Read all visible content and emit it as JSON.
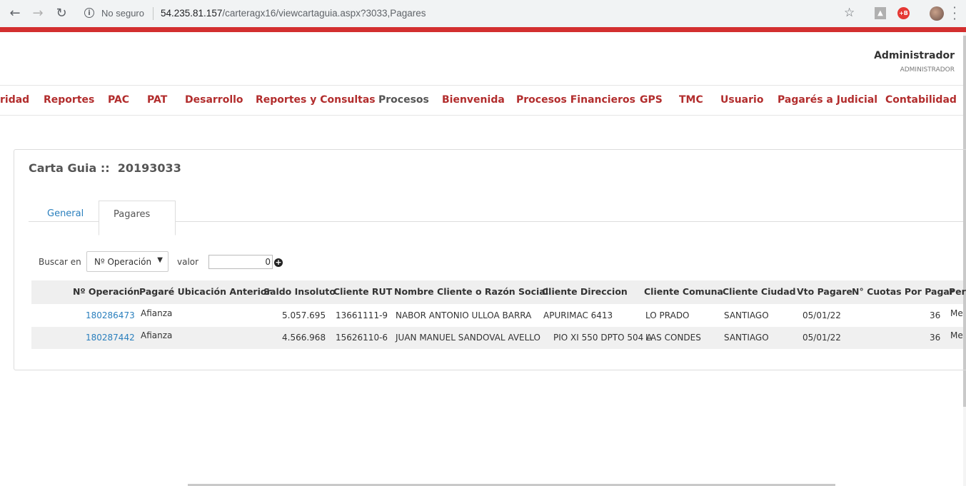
{
  "browser": {
    "security_label": "No seguro",
    "url_host": "54.235.81.157",
    "url_path": "/carteragx16/viewcartaguia.aspx?3033,Pagares",
    "ext_red_label": "+B"
  },
  "user": {
    "name": "Administrador",
    "role": "ADMINISTRADOR"
  },
  "menu": [
    "ridad",
    "Reportes",
    "PAC",
    "PAT",
    "Desarrollo",
    "Reportes y Consultas",
    "Procesos",
    "Bienvenida",
    "Procesos Financieros",
    "GPS",
    "TMC",
    "Usuario",
    "Pagarés a Judicial",
    "Contabilidad"
  ],
  "panel": {
    "title": "Carta Guia ::  20193033"
  },
  "tabs": {
    "general": "General",
    "pagares": "Pagares"
  },
  "filter": {
    "buscar_label": "Buscar en",
    "select_value": "Nº Operación",
    "valor_label": "valor",
    "valor_value": "0"
  },
  "table": {
    "headers": [
      "Nº Operación",
      "Pagaré Ubicación Anterior",
      "Saldo Insoluto",
      "Cliente RUT",
      "Nombre Cliente o Razón Social",
      "Cliente Direccion",
      "Cliente Comuna",
      "Cliente Ciudad",
      "Vto Pagare",
      "N° Cuotas Por Pagar",
      "Per"
    ],
    "rows": [
      [
        "180286473",
        "Afianza",
        "5.057.695",
        "13661111-9",
        "NABOR ANTONIO ULLOA BARRA",
        "APURIMAC 6413",
        "LO PRADO",
        "SANTIAGO",
        "05/01/22",
        "36",
        "Me"
      ],
      [
        "180287442",
        "Afianza",
        "4.566.968",
        "15626110-6",
        "JUAN MANUEL SANDOVAL AVELLO",
        "PIO XI 550 DPTO 504 A",
        "LAS CONDES",
        "SANTIAGO",
        "05/01/22",
        "36",
        "Me"
      ]
    ]
  }
}
